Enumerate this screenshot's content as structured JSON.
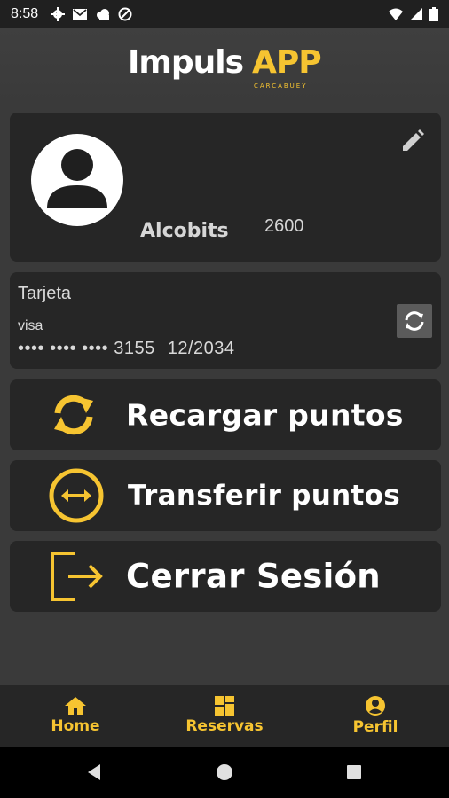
{
  "status_bar": {
    "time": "8:58",
    "left_icons": [
      "gear-icon",
      "mail-icon",
      "cloud-icon",
      "dnd-icon"
    ],
    "right_icons": [
      "wifi-icon",
      "signal-icon",
      "battery-icon"
    ]
  },
  "header": {
    "logo_main": "Impuls",
    "logo_accent": "APP",
    "logo_sub": "CARCABUEY"
  },
  "profile": {
    "name": "Alcobits",
    "points": "2600"
  },
  "card": {
    "title": "Tarjeta",
    "brand": "visa",
    "number": "•••• •••• •••• 3155",
    "expiry": "12/2034"
  },
  "actions": {
    "recharge": "Recargar puntos",
    "transfer": "Transferir puntos",
    "logout": "Cerrar Sesión"
  },
  "bottom_nav": {
    "home": "Home",
    "reservas": "Reservas",
    "perfil": "Perfil"
  },
  "colors": {
    "accent": "#f6c431",
    "background": "#3a3a3a",
    "card": "#262626"
  }
}
